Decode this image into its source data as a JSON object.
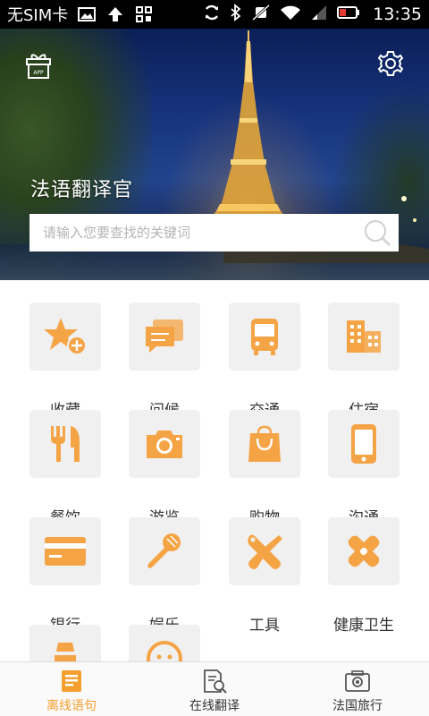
{
  "status_bar": {
    "carrier": "无SIM卡",
    "time": "13:35",
    "icons": [
      "image-icon",
      "upload-icon",
      "apps-icon",
      "sync-icon",
      "bluetooth-icon",
      "mute-icon",
      "wifi-icon",
      "signal-icon",
      "battery-icon"
    ]
  },
  "header": {
    "title": "法语翻译官",
    "gift_icon": "gift-icon",
    "settings_icon": "gear-icon",
    "gift_badge": "APP"
  },
  "search": {
    "placeholder": "请输入您要查找的关键词",
    "value": ""
  },
  "categories": [
    {
      "label": "收藏",
      "icon": "star-add-icon"
    },
    {
      "label": "问候",
      "icon": "chat-bubbles-icon"
    },
    {
      "label": "交通",
      "icon": "bus-icon"
    },
    {
      "label": "住宿",
      "icon": "building-icon"
    },
    {
      "label": "餐饮",
      "icon": "fork-knife-icon"
    },
    {
      "label": "游览",
      "icon": "camera-icon"
    },
    {
      "label": "购物",
      "icon": "shopping-bag-icon"
    },
    {
      "label": "沟通",
      "icon": "phone-icon"
    },
    {
      "label": "银行",
      "icon": "bank-card-icon"
    },
    {
      "label": "娱乐",
      "icon": "microphone-icon"
    },
    {
      "label": "工具",
      "icon": "tools-icon"
    },
    {
      "label": "健康卫生",
      "icon": "bandage-icon"
    },
    {
      "label": "",
      "icon": "cone-icon"
    },
    {
      "label": "",
      "icon": "face-icon"
    }
  ],
  "bottom_nav": [
    {
      "label": "离线语句",
      "icon": "book-icon",
      "active": true
    },
    {
      "label": "在线翻译",
      "icon": "document-search-icon",
      "active": false
    },
    {
      "label": "法国旅行",
      "icon": "camera-travel-icon",
      "active": false
    }
  ],
  "colors": {
    "accent": "#f59f2e",
    "tile_bg": "#f0f0f0",
    "text": "#333333"
  }
}
